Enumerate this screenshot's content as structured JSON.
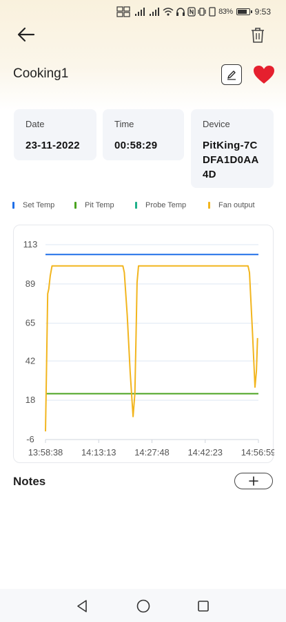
{
  "status_bar": {
    "battery": "83%",
    "time": "9:53"
  },
  "header": {
    "title": "Cooking1",
    "back_icon": "arrow-left-icon",
    "delete_icon": "trash-icon",
    "edit_icon": "pencil-icon",
    "favorite_icon": "heart-icon",
    "favorite_color": "#e5202e"
  },
  "info": {
    "date_label": "Date",
    "date_value": "23-11-2022",
    "time_label": "Time",
    "time_value": "00:58:29",
    "device_label": "Device",
    "device_value": "PitKing-7CDFA1D0AA4D"
  },
  "legend": [
    {
      "label": "Set Temp",
      "color": "#1f6fe8"
    },
    {
      "label": "Pit Temp",
      "color": "#4aa31f"
    },
    {
      "label": "Probe Temp",
      "color": "#1fb08a"
    },
    {
      "label": "Fan output",
      "color": "#f2b51e"
    }
  ],
  "chart_data": {
    "type": "line",
    "y_ticks": [
      -6,
      18,
      42,
      65,
      89,
      113
    ],
    "x_ticks": [
      "13:58:38",
      "14:13:13",
      "14:27:48",
      "14:42:23",
      "14:56:59"
    ],
    "ylim": [
      -6,
      113
    ],
    "grid": true,
    "legend_position": "top",
    "x_minutes_range": [
      0,
      58.35
    ],
    "series": [
      {
        "name": "Set Temp",
        "color": "#1f6fe8",
        "points": [
          [
            0,
            107
          ],
          [
            58.35,
            107
          ]
        ]
      },
      {
        "name": "Pit Temp",
        "color": "#4aa31f",
        "points": [
          [
            0,
            22
          ],
          [
            58.35,
            22
          ]
        ]
      },
      {
        "name": "Fan output",
        "color": "#f2b51e",
        "points": [
          [
            0,
            -1
          ],
          [
            0.3,
            40
          ],
          [
            0.6,
            83
          ],
          [
            0.9,
            86
          ],
          [
            1.3,
            94
          ],
          [
            1.8,
            100
          ],
          [
            21.2,
            100
          ],
          [
            21.6,
            96
          ],
          [
            22.4,
            70
          ],
          [
            23.2,
            35
          ],
          [
            24.0,
            8
          ],
          [
            24.5,
            22
          ],
          [
            24.8,
            55
          ],
          [
            25.1,
            90
          ],
          [
            25.5,
            100
          ],
          [
            55.5,
            100
          ],
          [
            55.9,
            96
          ],
          [
            56.7,
            60
          ],
          [
            57.4,
            26
          ],
          [
            57.8,
            36
          ],
          [
            58.1,
            56
          ]
        ]
      }
    ]
  },
  "notes": {
    "title": "Notes",
    "add_icon": "plus-icon"
  },
  "nav": {
    "back_icon": "triangle-back-icon",
    "home_icon": "circle-home-icon",
    "recent_icon": "square-recent-icon"
  }
}
